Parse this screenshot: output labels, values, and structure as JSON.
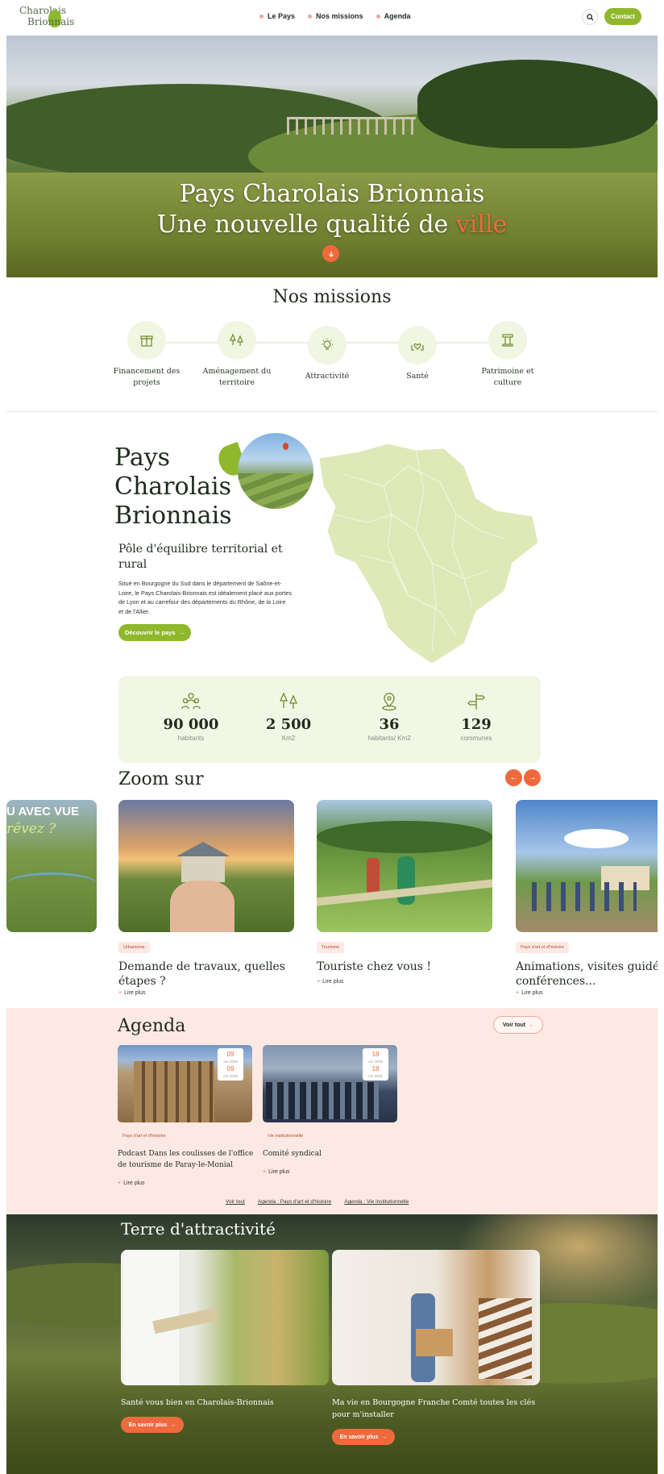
{
  "header": {
    "logo_line1": "Charolais",
    "logo_line2": "Brionnais",
    "nav": [
      "Le Pays",
      "Nos missions",
      "Agenda"
    ],
    "contact_label": "Contact"
  },
  "hero": {
    "title_line1": "Pays Charolais Brionnais",
    "title_line2_main": "Une nouvelle qualité de ",
    "title_line2_accent": "ville",
    "scroll_icon": "arrow-down-icon"
  },
  "missions": {
    "title": "Nos missions",
    "items": [
      {
        "label_l1": "Financement des",
        "label_l2": "projets",
        "icon": "gift-icon"
      },
      {
        "label_l1": "Aménagement du",
        "label_l2": "territoire",
        "icon": "trees-icon"
      },
      {
        "label_l1": "Attractivité",
        "label_l2": "",
        "icon": "lightbulb-icon"
      },
      {
        "label_l1": "Santé",
        "label_l2": "",
        "icon": "heart-hands-icon"
      },
      {
        "label_l1": "Patrimoine et",
        "label_l2": "culture",
        "icon": "column-icon"
      }
    ]
  },
  "pays": {
    "title_l1": "Pays",
    "title_l2": "Charolais",
    "title_l3": "Brionnais",
    "subtitle": "Pôle d'équilibre territorial et rural",
    "text": "Situé en Bourgogne du Sud dans le département de Saône-et-Loire, le Pays Charolais-Brionnais est idéalement placé aux portes de Lyon et au carrefour des départements du Rhône, de la Loire et de l'Allier.",
    "button": "Découvrir le pays"
  },
  "stats": [
    {
      "value": "90 000",
      "unit": "habitants",
      "icon": "people-icon"
    },
    {
      "value": "2 500",
      "unit": "Km2",
      "icon": "trees-icon"
    },
    {
      "value": "36",
      "unit": "habitants/ Km2",
      "icon": "map-pin-icon"
    },
    {
      "value": "129",
      "unit": "communes",
      "icon": "signpost-icon"
    }
  ],
  "zoom": {
    "title": "Zoom sur",
    "partial_text_l1": "U AVEC VUE",
    "partial_text_l2": "rêvez ?",
    "cards": [
      {
        "tag": "Urbanisme",
        "title_l1": "Demande de travaux, quelles",
        "title_l2": "étapes ?",
        "link": "Lire plus"
      },
      {
        "tag": "Tourisme",
        "title_l1": "Touriste chez vous !",
        "title_l2": "",
        "link": "Lire plus"
      },
      {
        "tag": "Pays d'art et d'histoire",
        "title_l1": "Animations, visites guidées,",
        "title_l2": "conférences...",
        "link": "Lire plus"
      }
    ]
  },
  "agenda": {
    "title": "Agenda",
    "see_all": "Voir tout",
    "events": [
      {
        "day1": "09",
        "mon1": "Avr 2026",
        "day2": "09",
        "mon2": "Avr 2026",
        "tag": "Pays d'art et d'histoire",
        "title_l1": "Podcast Dans les coulisses de l'office",
        "title_l2": "de tourisme de Paray-le-Monial",
        "link": "Lire plus"
      },
      {
        "day1": "18",
        "mon1": "Avr 2026",
        "day2": "18",
        "mon2": "Avr 2026",
        "tag": "Vie institutionnelle",
        "title_l1": "Comité syndical",
        "title_l2": "",
        "link": "Lire plus"
      }
    ],
    "links": [
      "Voir tout",
      "Agenda : Pays d'art et d'histoire",
      "Agenda : Vie institutionnelle"
    ]
  },
  "terre": {
    "title": "Terre d'attractivité",
    "cards": [
      {
        "text_l1": "Santé vous bien en Charolais-Brionnais",
        "text_l2": "",
        "button": "En savoir plus"
      },
      {
        "text_l1": "Ma vie en Bourgogne Franche Comté toutes les clés",
        "text_l2": "pour m'installer",
        "button": "En savoir plus"
      }
    ]
  },
  "colors": {
    "green": "#8fb82c",
    "orange": "#ee6a3c",
    "pink": "#fde9e3",
    "mint": "#f1f7e4"
  }
}
